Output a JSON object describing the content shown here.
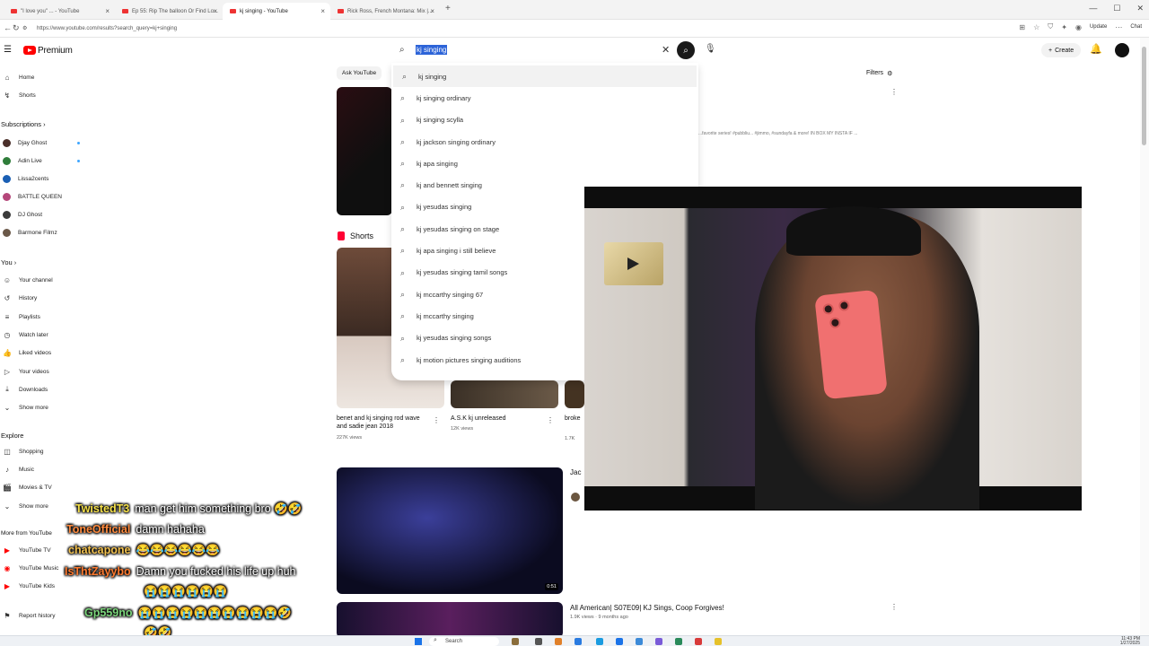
{
  "browser": {
    "tabs": [
      {
        "title": "\"I love you\" ... - YouTube"
      },
      {
        "title": "Ep 55: Rip The balloon Or Find Lo..."
      },
      {
        "title": "kj singing - YouTube"
      },
      {
        "title": "Rick Ross, French Montana: Mix |..."
      }
    ],
    "url": "https://www.youtube.com/results?search_query=kj+singing",
    "update_label": "Update",
    "chat_label": "Chat"
  },
  "youtube": {
    "brand": "Premium",
    "create_label": "Create",
    "search": {
      "value": "kj singing",
      "suggestions": [
        {
          "bold": "",
          "rest": "kj singing"
        },
        {
          "bold": "",
          "rest": "kj singing ordinary"
        },
        {
          "bold": "",
          "rest": "kj singing scylla"
        },
        {
          "bold": "",
          "rest": "kj jackson singing ordinary"
        },
        {
          "bold": "",
          "rest": "kj apa singing"
        },
        {
          "bold": "",
          "rest": "kj and bennett singing"
        },
        {
          "bold": "",
          "rest": "kj yesudas singing"
        },
        {
          "bold": "",
          "rest": "kj yesudas singing on stage"
        },
        {
          "bold": "",
          "rest": "kj apa singing i still believe"
        },
        {
          "bold": "",
          "rest": "kj yesudas singing tamil songs"
        },
        {
          "bold": "",
          "rest": "kj mccarthy singing 67"
        },
        {
          "bold": "",
          "rest": "kj mccarthy singing"
        },
        {
          "bold": "",
          "rest": "kj yesudas singing songs"
        },
        {
          "bold": "",
          "rest": "kj motion pictures singing auditions"
        }
      ]
    },
    "sidebar": {
      "home": "Home",
      "shorts": "Shorts",
      "subscriptions": "Subscriptions",
      "subs": [
        "Djay Ghost",
        "Adin Live",
        "Lissa2cents",
        "BATTLE QUEEN",
        "DJ Ghost",
        "Barmone Filmz"
      ],
      "you": "You",
      "you_items": [
        "Your channel",
        "History",
        "Playlists",
        "Watch later",
        "Liked videos",
        "Your videos",
        "Downloads",
        "Show more"
      ],
      "explore": "Explore",
      "explore_items": [
        "Shopping",
        "Music",
        "Movies & TV",
        "Show more"
      ],
      "more_from": "More from YouTube",
      "more_items": [
        "YouTube TV",
        "YouTube Music",
        "YouTube Kids"
      ],
      "report": "Report history"
    },
    "chips": [
      "Ask YouTube"
    ],
    "filters_label": "Filters",
    "result1_desc": "...favorite series! #pubbliu... #jimmo, #sundayfa & more! IN BOX MY INSTA IF ...",
    "shorts_label": "Shorts",
    "shorts": [
      {
        "title": "benet and kj singing rod wave and sadie jean 2018",
        "views": "227K views"
      },
      {
        "title": "A.S.K kj unreleased",
        "views": "12K views"
      },
      {
        "title": "broke",
        "views": "1.7K"
      }
    ],
    "video2": {
      "channel_partial": "Jac",
      "duration": "0:51"
    },
    "video3": {
      "title": "All American| S07E09| KJ Sings, Coop Forgives!",
      "meta": "1.9K views · 9 months ago"
    }
  },
  "chat": [
    {
      "user": "TwistedT3",
      "color": "#f5e04a",
      "msg": "man get him something bro 🤣🤣"
    },
    {
      "user": "ToneOfficial",
      "color": "#ff8a3d",
      "msg": "damn hahaha"
    },
    {
      "user": "chatcapone",
      "color": "#f2c14e",
      "msg": "😂😂😂😂😂😂"
    },
    {
      "user": "IsThtZayybo",
      "color": "#ff7a2f",
      "msg": "Damn you fucked his life up huh"
    },
    {
      "user": "",
      "color": "#ffffff",
      "msg": "😭😭😭😭😭😭"
    },
    {
      "user": "Gp559no",
      "color": "#7bd67b",
      "msg": "😭😭😭😭😭😭😭😭😭😭🤣"
    },
    {
      "user": "",
      "color": "#ffffff",
      "msg": "🤣🤣"
    }
  ],
  "taskbar": {
    "search_label": "Search",
    "time": "11:43 PM",
    "date": "1/27/2025"
  }
}
